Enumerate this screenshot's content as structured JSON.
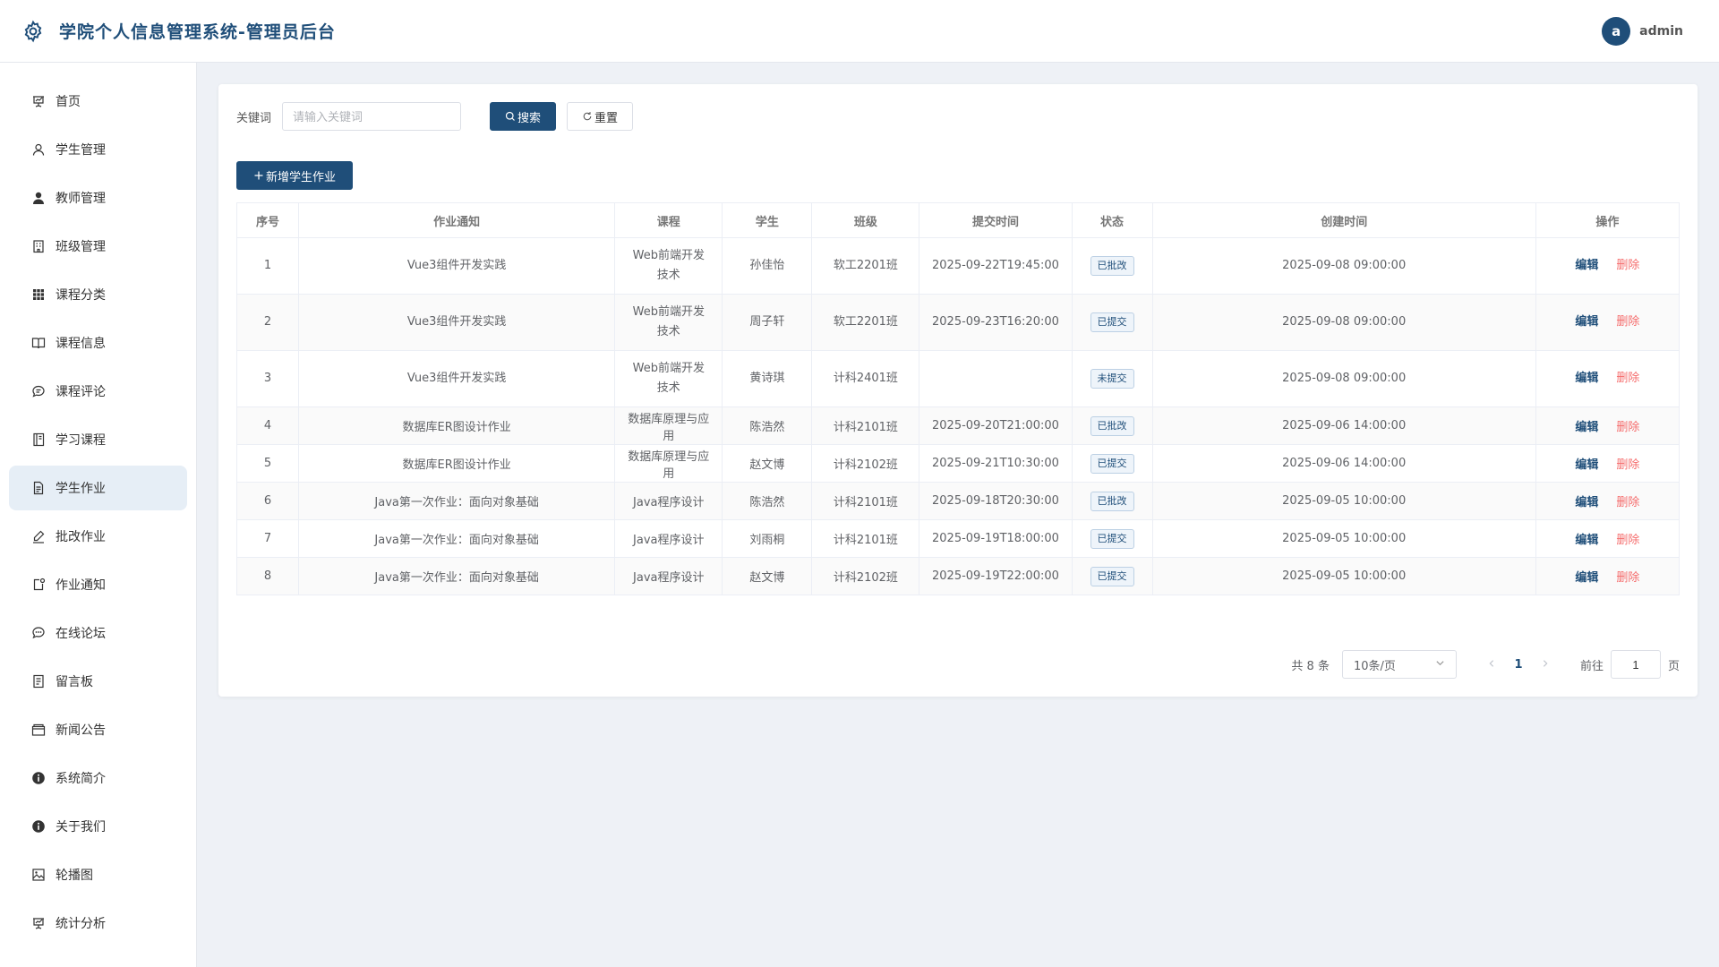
{
  "header": {
    "title": "学院个人信息管理系统-管理员后台",
    "avatar_letter": "a",
    "username": "admin"
  },
  "sidebar": {
    "items": [
      {
        "label": "首页",
        "icon": "presentation-icon"
      },
      {
        "label": "学生管理",
        "icon": "user-icon"
      },
      {
        "label": "教师管理",
        "icon": "user-filled-icon"
      },
      {
        "label": "班级管理",
        "icon": "building-icon"
      },
      {
        "label": "课程分类",
        "icon": "grid-icon"
      },
      {
        "label": "课程信息",
        "icon": "book-icon"
      },
      {
        "label": "课程评论",
        "icon": "chat-icon"
      },
      {
        "label": "学习课程",
        "icon": "notebook-icon"
      },
      {
        "label": "学生作业",
        "icon": "document-icon"
      },
      {
        "label": "批改作业",
        "icon": "edit-pen-icon"
      },
      {
        "label": "作业通知",
        "icon": "notification-icon"
      },
      {
        "label": "在线论坛",
        "icon": "chat-dot-icon"
      },
      {
        "label": "留言板",
        "icon": "tickets-icon"
      },
      {
        "label": "新闻公告",
        "icon": "wallet-icon"
      },
      {
        "label": "系统简介",
        "icon": "info-filled-icon"
      },
      {
        "label": "关于我们",
        "icon": "info-filled-icon"
      },
      {
        "label": "轮播图",
        "icon": "picture-icon"
      },
      {
        "label": "统计分析",
        "icon": "presentation-icon"
      }
    ],
    "active_index": 8
  },
  "search": {
    "keyword_label": "关键词",
    "placeholder": "请输入关键词",
    "search_label": "搜索",
    "reset_label": "重置"
  },
  "actions": {
    "add_label": "新增学生作业"
  },
  "table": {
    "columns": [
      "序号",
      "作业通知",
      "课程",
      "学生",
      "班级",
      "提交时间",
      "状态",
      "创建时间",
      "操作"
    ],
    "edit_label": "编辑",
    "delete_label": "删除",
    "rows": [
      {
        "index": "1",
        "notice": "Vue3组件开发实践",
        "course": "Web前端开发技术",
        "student": "孙佳怡",
        "class": "软工2201班",
        "submit_time": "2025-09-22T19:45:00",
        "status": "已批改",
        "created": "2025-09-08 09:00:00"
      },
      {
        "index": "2",
        "notice": "Vue3组件开发实践",
        "course": "Web前端开发技术",
        "student": "周子轩",
        "class": "软工2201班",
        "submit_time": "2025-09-23T16:20:00",
        "status": "已提交",
        "created": "2025-09-08 09:00:00"
      },
      {
        "index": "3",
        "notice": "Vue3组件开发实践",
        "course": "Web前端开发技术",
        "student": "黄诗琪",
        "class": "计科2401班",
        "submit_time": "",
        "status": "未提交",
        "created": "2025-09-08 09:00:00"
      },
      {
        "index": "4",
        "notice": "数据库ER图设计作业",
        "course": "数据库原理与应用",
        "student": "陈浩然",
        "class": "计科2101班",
        "submit_time": "2025-09-20T21:00:00",
        "status": "已批改",
        "created": "2025-09-06 14:00:00"
      },
      {
        "index": "5",
        "notice": "数据库ER图设计作业",
        "course": "数据库原理与应用",
        "student": "赵文博",
        "class": "计科2102班",
        "submit_time": "2025-09-21T10:30:00",
        "status": "已提交",
        "created": "2025-09-06 14:00:00"
      },
      {
        "index": "6",
        "notice": "Java第一次作业：面向对象基础",
        "course": "Java程序设计",
        "student": "陈浩然",
        "class": "计科2101班",
        "submit_time": "2025-09-18T20:30:00",
        "status": "已批改",
        "created": "2025-09-05 10:00:00"
      },
      {
        "index": "7",
        "notice": "Java第一次作业：面向对象基础",
        "course": "Java程序设计",
        "student": "刘雨桐",
        "class": "计科2101班",
        "submit_time": "2025-09-19T18:00:00",
        "status": "已提交",
        "created": "2025-09-05 10:00:00"
      },
      {
        "index": "8",
        "notice": "Java第一次作业：面向对象基础",
        "course": "Java程序设计",
        "student": "赵文博",
        "class": "计科2102班",
        "submit_time": "2025-09-19T22:00:00",
        "status": "已提交",
        "created": "2025-09-05 10:00:00"
      }
    ]
  },
  "pagination": {
    "total_text": "共 8 条",
    "page_size": "10条/页",
    "current_page": "1",
    "goto_label": "前往",
    "goto_value": "1",
    "page_suffix": "页"
  },
  "colors": {
    "primary": "#1f4e79",
    "danger": "#f56c6c",
    "background": "#eef1f6"
  }
}
